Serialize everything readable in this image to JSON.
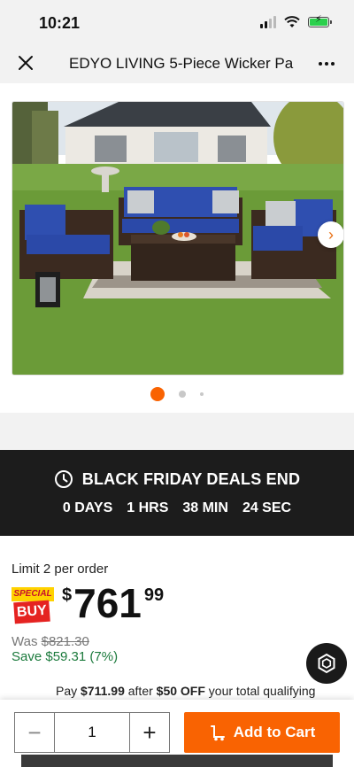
{
  "status_bar": {
    "time": "10:21"
  },
  "header": {
    "title": "EDYO LIVING 5-Piece Wicker Pa"
  },
  "carousel": {
    "total_images": 3,
    "active_index": 0
  },
  "deals": {
    "title": "BLACK FRIDAY DEALS END",
    "days": "0 DAYS",
    "hours": "1 HRS",
    "minutes": "38 MIN",
    "seconds": "24 SEC"
  },
  "pricing": {
    "limit_text": "Limit 2 per order",
    "badge_top": "SPECIAL",
    "badge_bottom": "BUY",
    "currency": "$",
    "price_dollars": "761",
    "price_cents": "99",
    "was_label": "Was ",
    "was_price": "$821.30",
    "save_text": "Save $59.31 (7%)",
    "pay_prefix": "Pay ",
    "pay_amount": "$711.99",
    "pay_middle": " after ",
    "pay_discount": "$50 OFF",
    "pay_suffix": " your total qualifying"
  },
  "cart": {
    "quantity": "1",
    "add_label": "Add to Cart"
  },
  "colors": {
    "accent_orange": "#f96302",
    "save_green": "#1b7a3c",
    "banner_black": "#1c1c1c"
  },
  "icons": [
    "close-icon",
    "more-icon",
    "chevron-right-icon",
    "clock-icon",
    "minus-icon",
    "plus-icon",
    "cart-icon",
    "chat-icon",
    "wifi-icon",
    "battery-icon",
    "signal-icon"
  ]
}
